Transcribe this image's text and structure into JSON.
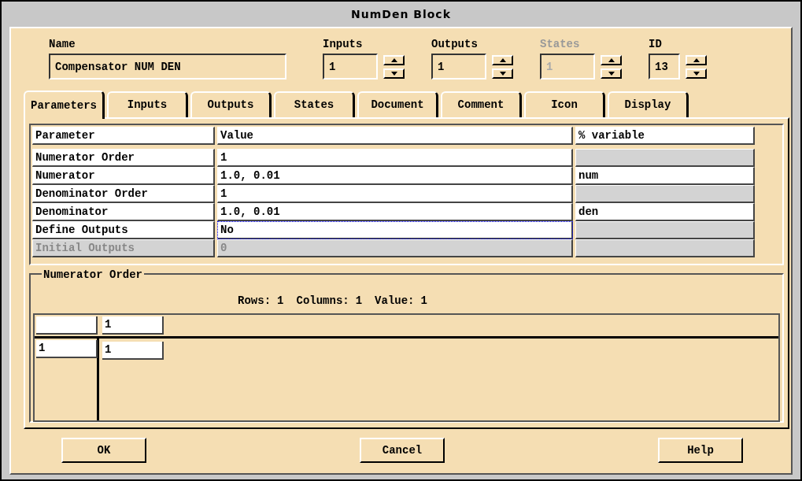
{
  "window": {
    "title": "NumDen Block"
  },
  "fields": [
    {
      "label": "Name",
      "value": "Compensator NUM DEN",
      "kind": "text",
      "disabled": false
    },
    {
      "label": "Inputs",
      "value": "1",
      "kind": "spin",
      "disabled": false
    },
    {
      "label": "Outputs",
      "value": "1",
      "kind": "spin",
      "disabled": false
    },
    {
      "label": "States",
      "value": "1",
      "kind": "spin",
      "disabled": true
    },
    {
      "label": "ID",
      "value": "13",
      "kind": "spin",
      "disabled": false
    }
  ],
  "tabs": [
    {
      "label": "Parameters",
      "selected": true
    },
    {
      "label": "Inputs",
      "selected": false
    },
    {
      "label": "Outputs",
      "selected": false
    },
    {
      "label": "States",
      "selected": false
    },
    {
      "label": "Document",
      "selected": false
    },
    {
      "label": "Comment",
      "selected": false
    },
    {
      "label": "Icon",
      "selected": false
    },
    {
      "label": "Display",
      "selected": false
    }
  ],
  "table": {
    "columns": [
      "Parameter",
      "Value",
      "% variable"
    ],
    "rows": [
      {
        "parameter": "Numerator Order",
        "value": "1",
        "variable_editable": false,
        "disabled": false,
        "focused": false
      },
      {
        "parameter": "Numerator",
        "value": "1.0, 0.01",
        "variable": "num",
        "variable_editable": true,
        "disabled": false,
        "focused": false
      },
      {
        "parameter": "Denominator Order",
        "value": "1",
        "variable_editable": false,
        "disabled": false,
        "focused": false
      },
      {
        "parameter": "Denominator",
        "value": "1.0, 0.01",
        "variable": "den",
        "variable_editable": true,
        "disabled": false,
        "focused": false
      },
      {
        "parameter": "Define Outputs",
        "value": "No",
        "variable_editable": false,
        "disabled": false,
        "focused": true
      },
      {
        "parameter": "Initial Outputs",
        "value": "0",
        "variable_editable": false,
        "disabled": true,
        "focused": false
      }
    ]
  },
  "matrix": {
    "title": "Numerator Order",
    "summary": [
      {
        "label": "Rows:",
        "value": "1"
      },
      {
        "label": "Columns:",
        "value": "1"
      },
      {
        "label": "Value:",
        "value": "1"
      }
    ],
    "column_headers": [
      "1"
    ],
    "rows": [
      {
        "header": "1",
        "cells": [
          "1"
        ]
      }
    ]
  },
  "buttons": [
    "OK",
    "Cancel",
    "Help"
  ]
}
